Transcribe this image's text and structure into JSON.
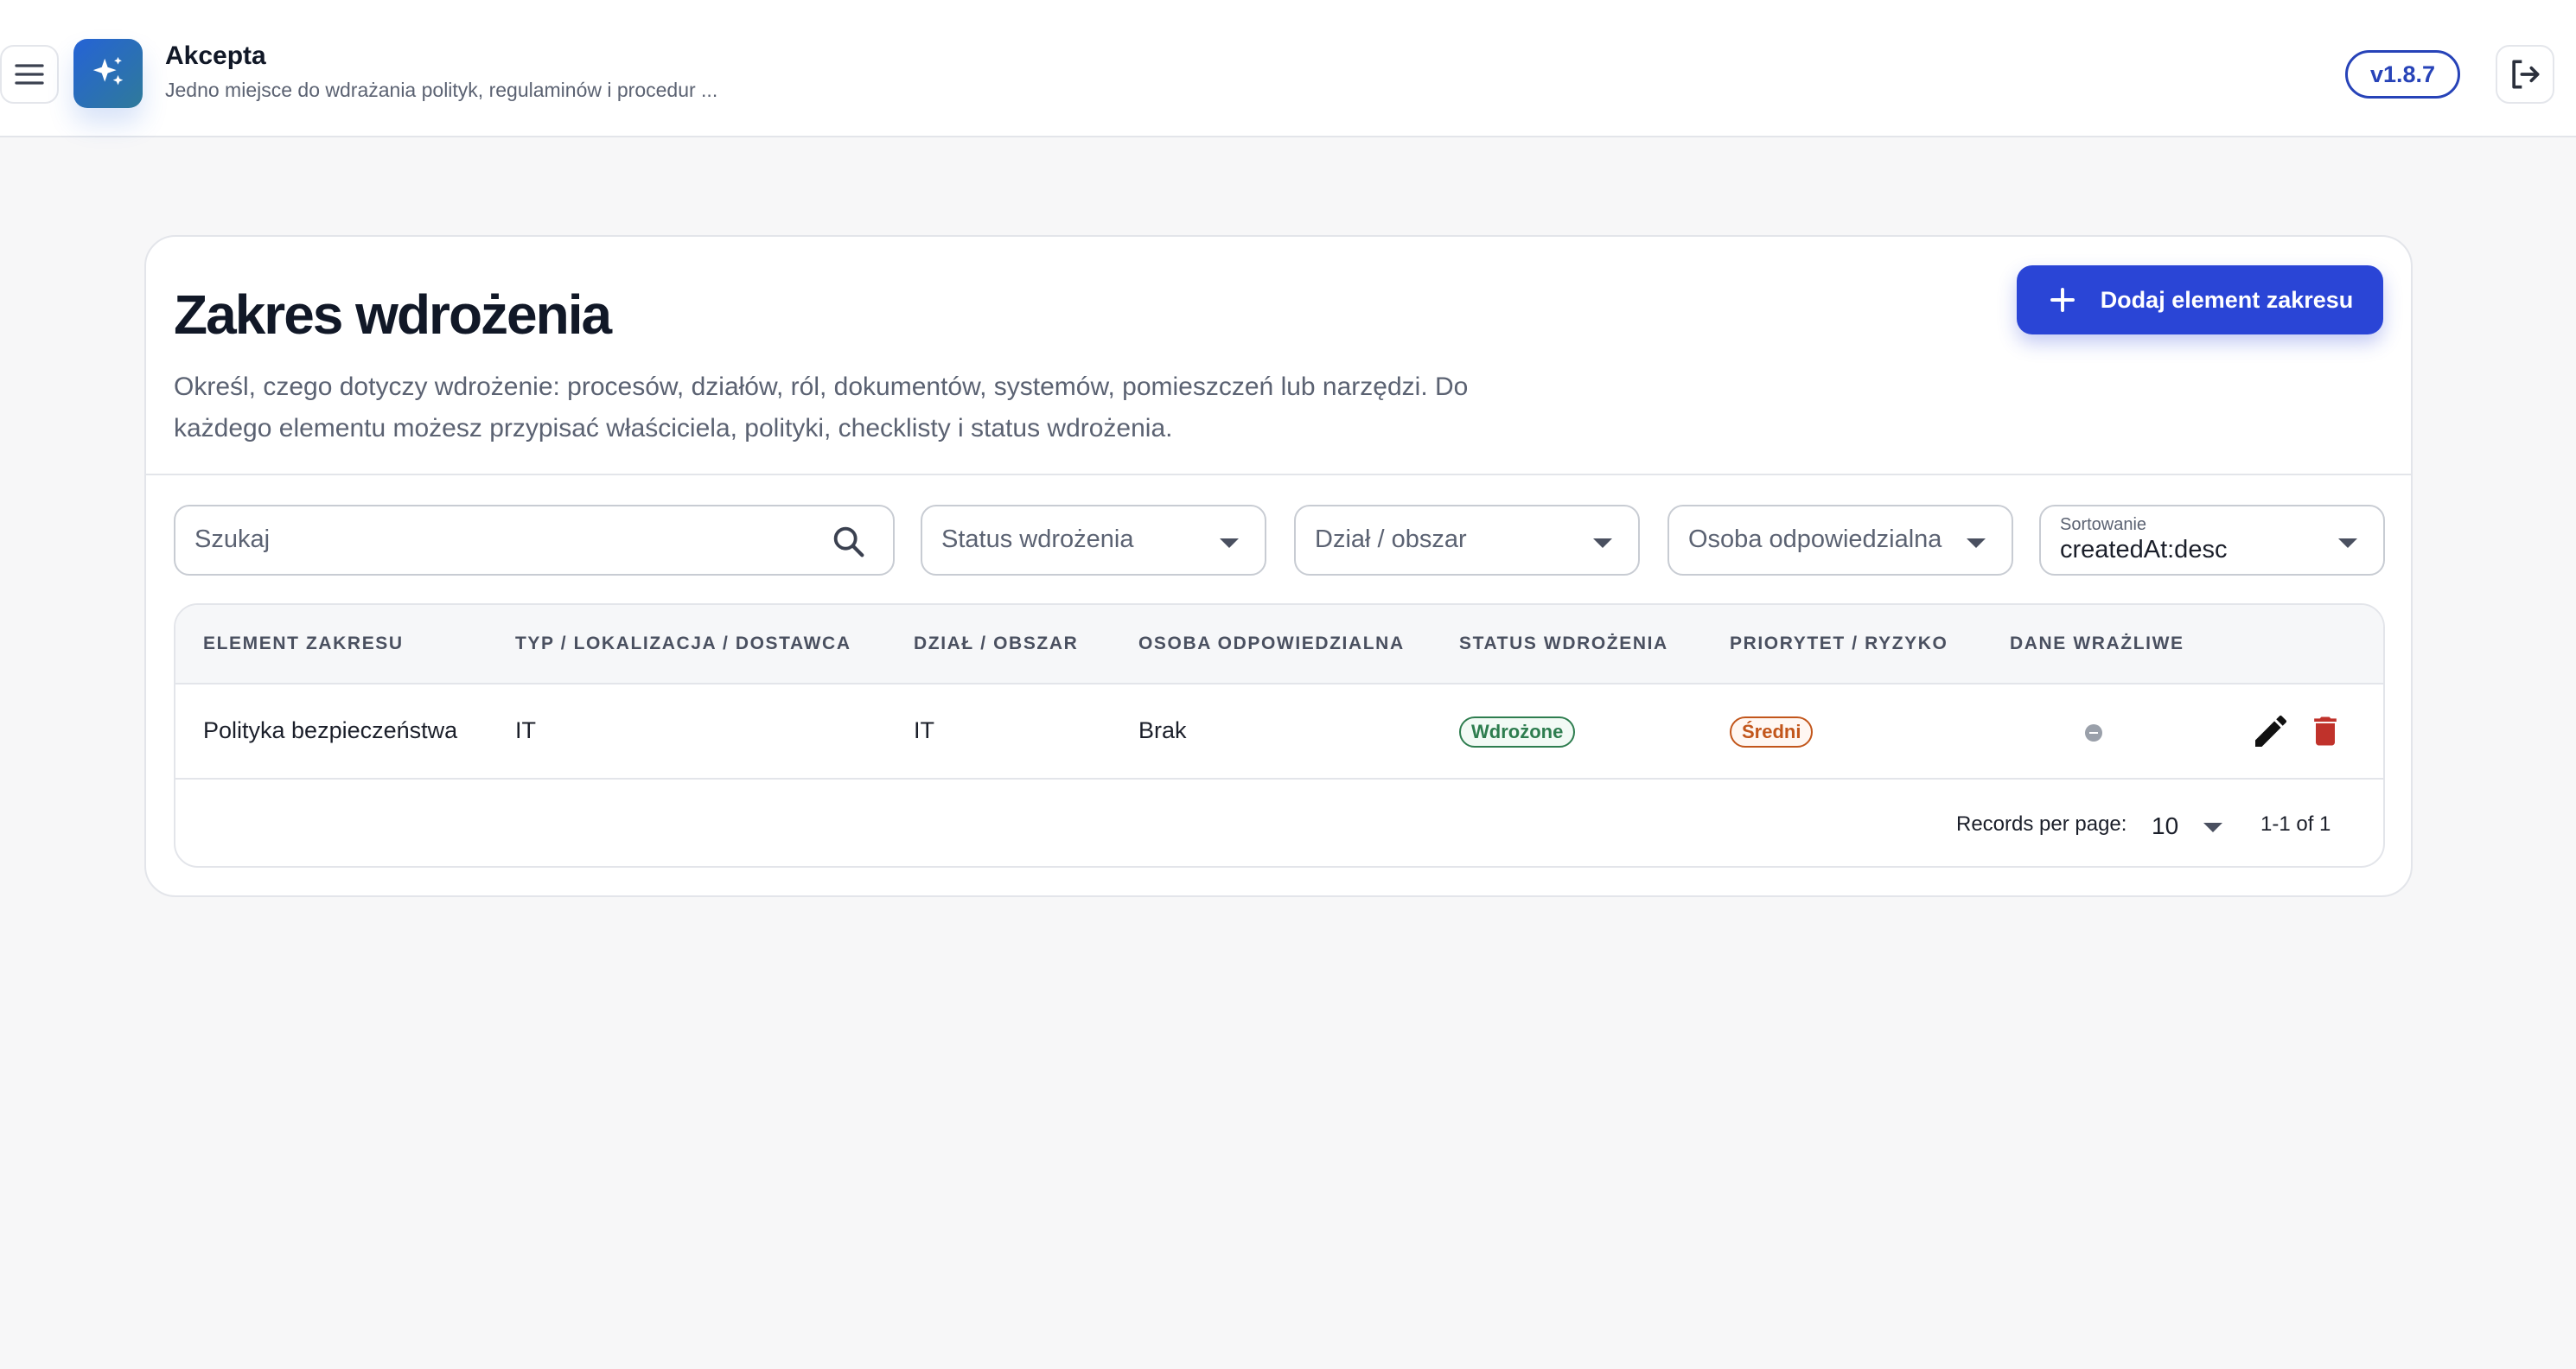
{
  "app": {
    "name": "Akcepta",
    "tagline": "Jedno miejsce do wdrażania polityk, regulaminów i procedur ...",
    "version": "v1.8.7",
    "logo_icon": "sparkles-icon",
    "accent_color": "#2a45d6"
  },
  "page": {
    "title": "Zakres wdrożenia",
    "description": "Określ, czego dotyczy wdrożenie: procesów, działów, ról, dokumentów, systemów, pomieszczeń lub narzędzi. Do każdego elementu możesz przypisać właściciela, polityki, checklisty i status wdrożenia.",
    "add_button_label": "Dodaj element zakresu"
  },
  "filters": {
    "search_placeholder": "Szukaj",
    "status_placeholder": "Status wdrożenia",
    "department_placeholder": "Dział / obszar",
    "owner_placeholder": "Osoba odpowiedzialna",
    "sort_label": "Sortowanie",
    "sort_value": "createdAt:desc"
  },
  "table": {
    "columns": [
      "ELEMENT ZAKRESU",
      "TYP / LOKALIZACJA / DOSTAWCA",
      "DZIAŁ / OBSZAR",
      "OSOBA ODPOWIEDZIALNA",
      "STATUS WDROŻENIA",
      "PRIORYTET / RYZYKO",
      "DANE WRAŻLIWE"
    ],
    "rows": [
      {
        "element": "Polityka bezpieczeństwa",
        "type": "IT",
        "department": "IT",
        "owner": "Brak",
        "status": "Wdrożone",
        "priority": "Średni",
        "sensitive": "none"
      }
    ],
    "records_per_page_label": "Records per page:",
    "records_per_page": "10",
    "range": "1-1 of 1"
  }
}
